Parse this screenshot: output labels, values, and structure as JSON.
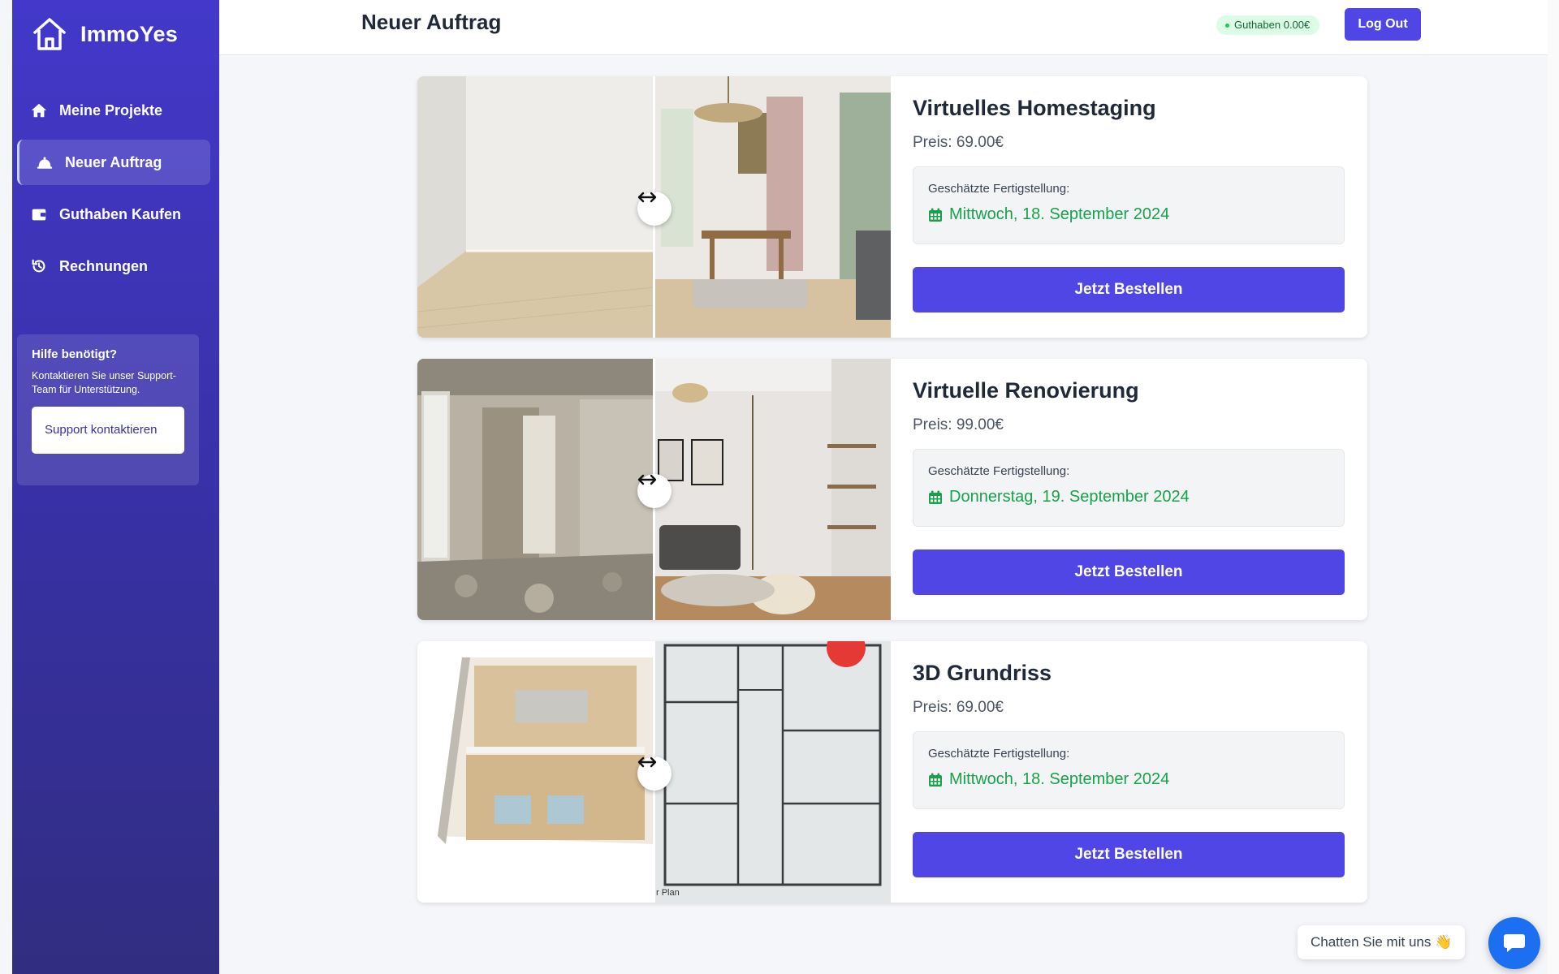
{
  "sidebar": {
    "brand": "ImmoYes",
    "items": [
      {
        "label": "Meine Projekte",
        "icon": "home-icon"
      },
      {
        "label": "Neuer Auftrag",
        "icon": "bell-icon",
        "active": true
      },
      {
        "label": "Guthaben Kaufen",
        "icon": "wallet-icon"
      },
      {
        "label": "Rechnungen",
        "icon": "history-icon"
      }
    ],
    "help": {
      "title": "Hilfe benötigt?",
      "text": "Kontaktieren Sie unser Support-Team für Unterstützung.",
      "button": "Support kontaktieren"
    }
  },
  "header": {
    "title": "Neuer Auftrag",
    "balance": "Guthaben 0.00€",
    "logout": "Log Out"
  },
  "cards": [
    {
      "title": "Virtuelles Homestaging",
      "price": "Preis: 69.00€",
      "eta_label": "Geschätzte Fertigstellung:",
      "eta_date": "Mittwoch, 18. September 2024",
      "button": "Jetzt Bestellen"
    },
    {
      "title": "Virtuelle Renovierung",
      "price": "Preis: 99.00€",
      "eta_label": "Geschätzte Fertigstellung:",
      "eta_date": "Donnerstag, 19. September 2024",
      "button": "Jetzt Bestellen"
    },
    {
      "title": "3D Grundriss",
      "price": "Preis: 69.00€",
      "eta_label": "Geschätzte Fertigstellung:",
      "eta_date": "Mittwoch, 18. September 2024",
      "button": "Jetzt Bestellen",
      "image_caption": "r Plan"
    }
  ],
  "chat": {
    "label": "Chatten Sie mit uns 👋"
  },
  "colors": {
    "sidebar": "#4338ca",
    "primary_button": "#4f46e5",
    "eta_green": "#16a34a",
    "chat_button": "#1d6ff2"
  }
}
